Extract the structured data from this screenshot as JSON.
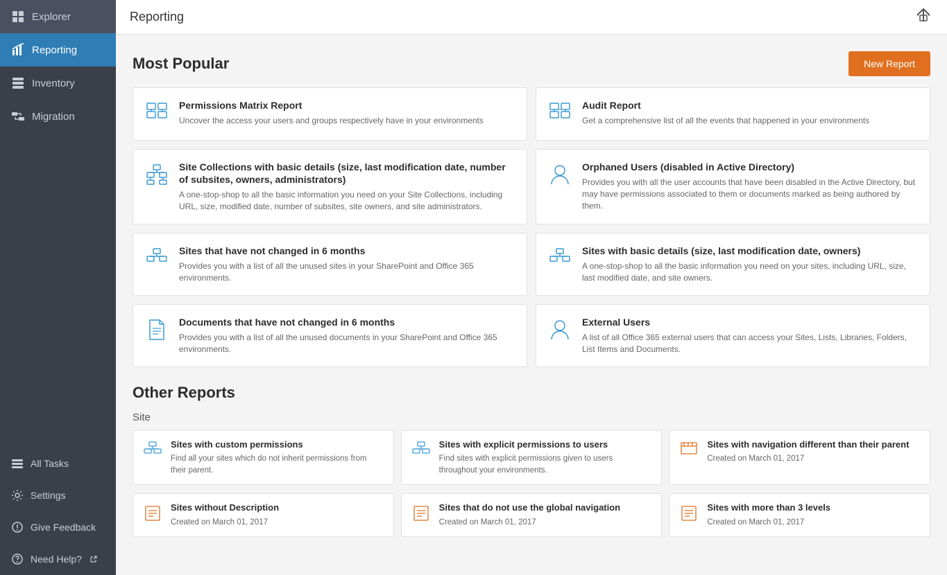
{
  "sidebar": {
    "items": [
      {
        "id": "explorer",
        "label": "Explorer",
        "icon": "explorer"
      },
      {
        "id": "reporting",
        "label": "Reporting",
        "icon": "reporting",
        "active": true
      },
      {
        "id": "inventory",
        "label": "Inventory",
        "icon": "inventory"
      },
      {
        "id": "migration",
        "label": "Migration",
        "icon": "migration"
      }
    ],
    "bottom_items": [
      {
        "id": "all-tasks",
        "label": "All Tasks",
        "icon": "tasks"
      },
      {
        "id": "settings",
        "label": "Settings",
        "icon": "settings"
      },
      {
        "id": "give-feedback",
        "label": "Give Feedback",
        "icon": "feedback"
      },
      {
        "id": "need-help",
        "label": "Need Help?",
        "icon": "help",
        "external": true
      }
    ]
  },
  "topbar": {
    "title": "Reporting",
    "breadcrumb": "Reporting"
  },
  "most_popular": {
    "heading": "Most Popular",
    "new_report_label": "New Report",
    "cards": [
      {
        "title": "Permissions Matrix Report",
        "desc": "Uncover the access your users and groups respectively have in your environments",
        "icon": "permissions"
      },
      {
        "title": "Audit Report",
        "desc": "Get a comprehensive list of all the events that happened in your environments",
        "icon": "audit"
      },
      {
        "title": "Site Collections with basic details (size, last modification date, number of subsites, owners, administrators)",
        "desc": "A one-stop-shop to all the basic information you need on your Site Collections, including URL, size, modified date, number of subsites, site owners, and site administrators.",
        "icon": "site-collections"
      },
      {
        "title": "Orphaned Users (disabled in Active Directory)",
        "desc": "Provides you with all the user accounts that have been disabled in the Active Directory, but may have permissions associated to them or documents marked as being authored by them.",
        "icon": "orphaned-users"
      },
      {
        "title": "Sites that have not changed in 6 months",
        "desc": "Provides you with a list of all the unused sites in your SharePoint and Office 365 environments.",
        "icon": "sites-unchanged"
      },
      {
        "title": "Sites with basic details (size, last modification date, owners)",
        "desc": "A one-stop-shop to all the basic information you need on your sites, including URL, size, last modified date, and site owners.",
        "icon": "sites-basic"
      },
      {
        "title": "Documents that have not changed in 6 months",
        "desc": "Provides you with a list of all the unused documents in your SharePoint and Office 365 environments.",
        "icon": "docs-unchanged"
      },
      {
        "title": "External Users",
        "desc": "A list of all Office 365 external users that can access your Sites, Lists, Libraries, Folders, List Items and Documents.",
        "icon": "external-users"
      }
    ]
  },
  "other_reports": {
    "heading": "Other Reports",
    "sections": [
      {
        "title": "Site",
        "cards": [
          {
            "title": "Sites with custom permissions",
            "desc": "Find all your sites which do not inherit permissions from their parent.",
            "icon": "sites-custom"
          },
          {
            "title": "Sites with explicit permissions to users",
            "desc": "Find sites with explicit permissions given to users throughout your environments.",
            "icon": "sites-explicit"
          },
          {
            "title": "Sites with navigation different than their parent",
            "desc": "Created on March 01, 2017",
            "icon": "sites-nav"
          },
          {
            "title": "Sites without Description",
            "desc": "Created on March 01, 2017",
            "icon": "sites-no-desc"
          },
          {
            "title": "Sites that do not use the global navigation",
            "desc": "Created on March 01, 2017",
            "icon": "sites-no-global-nav"
          },
          {
            "title": "Sites with more than 3 levels",
            "desc": "Created on March 01, 2017",
            "icon": "sites-levels"
          }
        ]
      }
    ]
  }
}
